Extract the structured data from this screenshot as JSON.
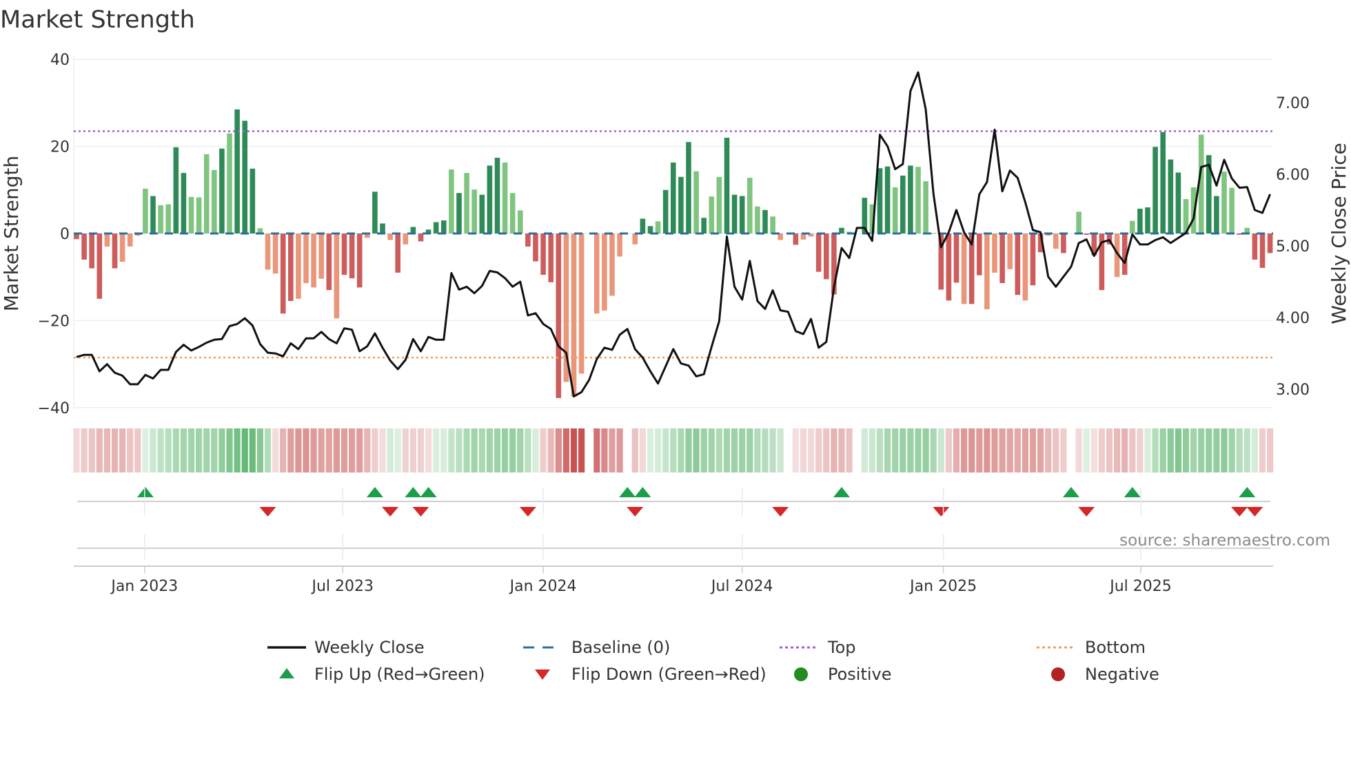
{
  "chart_data": {
    "type": "bar",
    "title": "Market Strength",
    "ylabel": "Market Strength",
    "y2label": "Weekly Close Price",
    "ylim": [
      -40,
      40
    ],
    "y2lim": [
      2.65,
      7.8
    ],
    "yticks": [
      "40",
      "20",
      "0",
      "−20",
      "−40"
    ],
    "yticks_values": [
      40,
      20,
      0,
      -20,
      -40
    ],
    "y2ticks": [
      "7.00",
      "6.00",
      "5.00",
      "4.00",
      "3.00"
    ],
    "y2ticks_values": [
      7,
      6,
      5,
      4,
      3
    ],
    "x_unit": "week index",
    "xticks": [
      {
        "label": "Jan 2023",
        "week": 8.9
      },
      {
        "label": "Jul 2023",
        "week": 34.8
      },
      {
        "label": "Jan 2024",
        "week": 61.0
      },
      {
        "label": "Jul 2024",
        "week": 87.0
      },
      {
        "label": "Jan 2025",
        "week": 113.3
      },
      {
        "label": "Jul 2025",
        "week": 139.1
      }
    ],
    "strength": [
      -1.3,
      -6,
      -8,
      -15,
      -3,
      -8,
      -6.5,
      -3,
      -0.5,
      10.3,
      8.6,
      6.5,
      6.7,
      19.8,
      13.9,
      8.4,
      8.3,
      18.2,
      14.6,
      19.5,
      23,
      28.5,
      25.9,
      14.9,
      1.2,
      -8.3,
      -9.2,
      -18.4,
      -15.5,
      -15,
      -11.4,
      -12.4,
      -10.4,
      -13,
      -19.5,
      -9.5,
      -10.3,
      -12.4,
      -1,
      9.6,
      2.3,
      -1.5,
      -9,
      -2.5,
      1.5,
      -1.8,
      0.9,
      2.6,
      3,
      14.7,
      9.3,
      13.9,
      10.1,
      8.9,
      15.6,
      17.4,
      16.3,
      9.3,
      5.3,
      -3,
      -6.4,
      -9.5,
      -11.2,
      -37.8,
      -34.1,
      -37.5,
      -32.2,
      0,
      -18.4,
      -17.7,
      -14.3,
      -5.3,
      0,
      -2.5,
      3.4,
      1.7,
      2.8,
      10,
      16.3,
      13,
      21,
      14.3,
      3.6,
      8.5,
      13,
      22,
      8.9,
      8.6,
      12.8,
      6.2,
      5.4,
      3.9,
      -1.5,
      0,
      -2.6,
      -1.4,
      -0.7,
      -8.8,
      -10.5,
      -14,
      1.3,
      0.4,
      0,
      8.2,
      6.7,
      15,
      15.4,
      10.6,
      13.3,
      15.6,
      15.3,
      12,
      0.1,
      -12.9,
      -15.4,
      -11.3,
      -16.2,
      -16.2,
      -9.6,
      -17.4,
      -9,
      -11.4,
      -8.2,
      -14.1,
      -15.4,
      -11.9,
      -4.3,
      -0.5,
      -3.5,
      -4.5,
      0,
      5,
      -0.3,
      -5,
      -13,
      -2.5,
      -10,
      -9.5,
      2.9,
      5.7,
      6,
      19.9,
      23.3,
      17,
      14,
      7.9,
      10.6,
      22.7,
      18,
      8.6,
      14.2,
      10.5,
      -0.3,
      1.3,
      -6,
      -7.9,
      -4.5
    ],
    "strength_tone": "ddddldlllldllddlllldldddlllddlllldldddlddldldddddldlldddllldddddllll0llll0ddlddddldlldddlldll0dllddddl0dlddlddllldddlddlldldlddlldd0ddddldlddddddlllddlldldddl",
    "weekly_close": [
      3.45,
      3.48,
      3.48,
      3.25,
      3.35,
      3.23,
      3.19,
      3.07,
      3.07,
      3.2,
      3.15,
      3.27,
      3.27,
      3.52,
      3.62,
      3.54,
      3.59,
      3.65,
      3.69,
      3.7,
      3.88,
      3.91,
      3.99,
      3.89,
      3.63,
      3.51,
      3.5,
      3.46,
      3.64,
      3.56,
      3.71,
      3.71,
      3.8,
      3.7,
      3.64,
      3.85,
      3.83,
      3.53,
      3.6,
      3.78,
      3.58,
      3.4,
      3.28,
      3.41,
      3.7,
      3.53,
      3.73,
      3.69,
      3.69,
      4.62,
      4.39,
      4.43,
      4.34,
      4.44,
      4.65,
      4.63,
      4.55,
      4.43,
      4.5,
      4.03,
      4.06,
      3.91,
      3.84,
      3.6,
      3.51,
      2.9,
      2.96,
      3.13,
      3.42,
      3.58,
      3.55,
      3.76,
      3.84,
      3.56,
      3.44,
      3.25,
      3.08,
      3.32,
      3.56,
      3.36,
      3.33,
      3.18,
      3.21,
      3.59,
      3.95,
      5.13,
      4.43,
      4.25,
      4.79,
      4.23,
      4.12,
      4.38,
      4.1,
      4.08,
      3.81,
      3.77,
      3.98,
      3.58,
      3.66,
      4.42,
      4.97,
      4.83,
      5.25,
      5.25,
      5.07,
      6.55,
      6.39,
      6.07,
      6.14,
      7.16,
      7.42,
      6.9,
      5.73,
      4.98,
      5.19,
      5.5,
      5.19,
      5.02,
      5.72,
      5.89,
      6.62,
      5.76,
      6.05,
      5.95,
      5.61,
      5.22,
      5.19,
      4.57,
      4.43,
      4.57,
      4.71,
      5.04,
      5.09,
      4.86,
      5.05,
      5.08,
      4.9,
      4.76,
      5.16,
      5.02,
      5.02,
      5.08,
      5.12,
      5.04,
      5.11,
      5.18,
      5.38,
      6.1,
      6.13,
      5.84,
      6.2,
      5.94,
      5.81,
      5.82,
      5.5,
      5.46,
      5.72
    ],
    "reference_lines": {
      "top": 23.5,
      "bottom": -28.5,
      "baseline": 0
    },
    "flip_up_weeks": [
      9,
      39,
      44,
      46,
      72,
      74,
      100,
      130,
      138,
      153
    ],
    "flip_down_weeks": [
      25,
      41,
      45,
      59,
      73,
      92,
      113,
      132,
      152,
      154
    ],
    "legend_position": "bottom",
    "legend": [
      {
        "label": "Weekly Close",
        "kind": "line"
      },
      {
        "label": "Baseline (0)",
        "kind": "dash"
      },
      {
        "label": "Top",
        "kind": "dot-top"
      },
      {
        "label": "Bottom",
        "kind": "dot-bottom"
      },
      {
        "label": "Flip Up (Red→Green)",
        "kind": "tri-up"
      },
      {
        "label": "Flip Down (Green→Red)",
        "kind": "tri-down"
      },
      {
        "label": "Positive",
        "kind": "dot-pos"
      },
      {
        "label": "Negative",
        "kind": "dot-neg"
      }
    ],
    "source": "source: sharemaestro.com",
    "colors": {
      "strong_pos": "#2e8b57",
      "weak_pos": "#7fc47f",
      "strong_neg": "#cd5c5c",
      "weak_neg": "#e9967a",
      "line": "#111111",
      "baseline": "#2b6ea3",
      "top": "#a05ce0",
      "bottom": "#f0a060",
      "flip_up": "#1a9e4a",
      "flip_down": "#d62728",
      "positive": "#228b22",
      "negative": "#b22222"
    }
  }
}
